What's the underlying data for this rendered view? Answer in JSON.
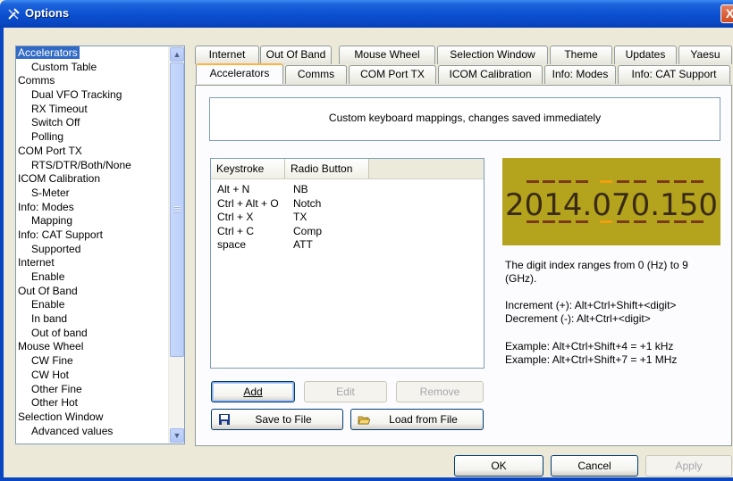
{
  "window": {
    "title": "Options",
    "close_glyph": "X"
  },
  "tree": {
    "items": [
      {
        "label": "Accelerators",
        "level": 0,
        "selected": true
      },
      {
        "label": "Custom Table",
        "level": 1
      },
      {
        "label": "Comms",
        "level": 0
      },
      {
        "label": "Dual VFO Tracking",
        "level": 1
      },
      {
        "label": "RX Timeout",
        "level": 1
      },
      {
        "label": "Switch Off",
        "level": 1
      },
      {
        "label": "Polling",
        "level": 1
      },
      {
        "label": "COM Port TX",
        "level": 0
      },
      {
        "label": "RTS/DTR/Both/None",
        "level": 1
      },
      {
        "label": "ICOM Calibration",
        "level": 0
      },
      {
        "label": "S-Meter",
        "level": 1
      },
      {
        "label": "Info: Modes",
        "level": 0
      },
      {
        "label": "Mapping",
        "level": 1
      },
      {
        "label": "Info: CAT Support",
        "level": 0
      },
      {
        "label": "Supported",
        "level": 1
      },
      {
        "label": "Internet",
        "level": 0
      },
      {
        "label": "Enable",
        "level": 1
      },
      {
        "label": "Out Of Band",
        "level": 0
      },
      {
        "label": "Enable",
        "level": 1
      },
      {
        "label": "In band",
        "level": 1
      },
      {
        "label": "Out of band",
        "level": 1
      },
      {
        "label": "Mouse Wheel",
        "level": 0
      },
      {
        "label": "CW Fine",
        "level": 1
      },
      {
        "label": "CW Hot",
        "level": 1
      },
      {
        "label": "Other Fine",
        "level": 1
      },
      {
        "label": "Other Hot",
        "level": 1
      },
      {
        "label": "Selection Window",
        "level": 0
      },
      {
        "label": "Advanced values",
        "level": 1
      }
    ]
  },
  "tabs": {
    "row1": [
      "Internet",
      "Out Of Band",
      "Mouse Wheel",
      "Selection Window",
      "Theme",
      "Updates",
      "Yaesu"
    ],
    "row2": [
      "Accelerators",
      "Comms",
      "COM Port TX",
      "ICOM Calibration",
      "Info: Modes",
      "Info: CAT Support"
    ],
    "active": "Accelerators"
  },
  "description": "Custom keyboard mappings, changes saved immediately",
  "keymap": {
    "columns": [
      "Keystroke",
      "Radio Button"
    ],
    "rows": [
      [
        "Alt + N",
        "NB"
      ],
      [
        "Ctrl + Alt + O",
        "Notch"
      ],
      [
        "Ctrl + X",
        "TX"
      ],
      [
        "Ctrl + C",
        "Comp"
      ],
      [
        "space",
        "ATT"
      ]
    ]
  },
  "buttons": {
    "add": "Add",
    "edit": "Edit",
    "remove": "Remove",
    "save_file": "Save to File",
    "load_file": "Load from File",
    "ok": "OK",
    "cancel": "Cancel",
    "apply": "Apply"
  },
  "frequency_display": {
    "value": "2014.070.150",
    "highlighted_digit_index": 5,
    "colors": {
      "background": "#b3a31d",
      "digits": "#3a2a14",
      "dash": "#7a3a1a",
      "highlight": "#f0a010"
    }
  },
  "info": {
    "line1": "The digit index ranges from 0 (Hz) to 9",
    "line2": "(GHz).",
    "increment": "Increment (+):  Alt+Ctrl+Shift+<digit>",
    "decrement": "Decrement (-):  Alt+Ctrl+<digit>",
    "example1": "Example:  Alt+Ctrl+Shift+4  =  +1 kHz",
    "example2": "Example:  Alt+Ctrl+Shift+7  =  +1 MHz"
  },
  "icons": {
    "title": "tools-icon",
    "save": "floppy-disk-icon",
    "load": "open-folder-icon"
  }
}
